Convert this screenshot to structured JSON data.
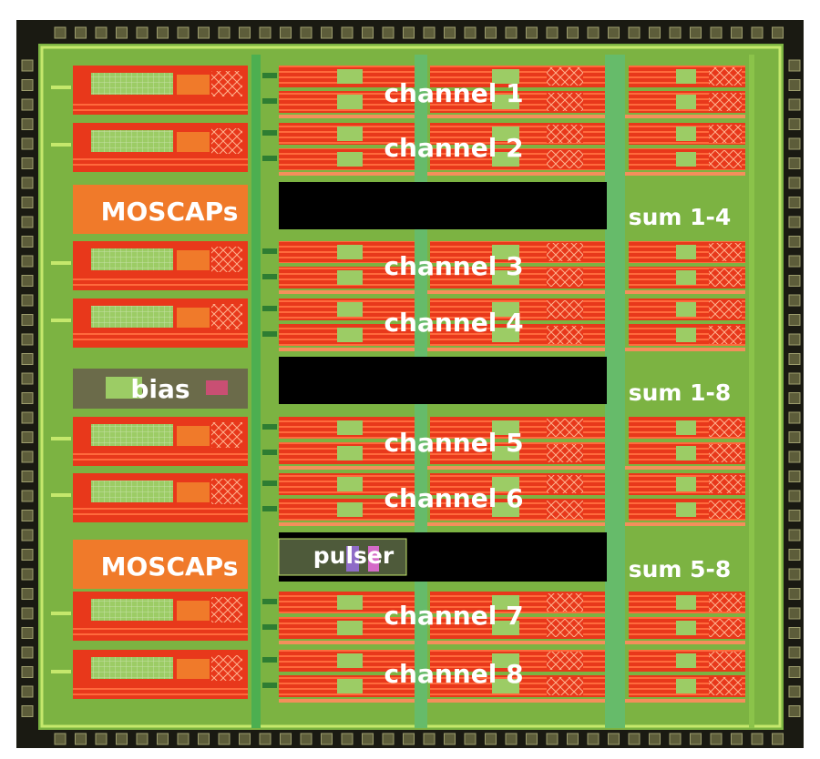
{
  "layout_title": "",
  "channels": [
    "channel 1",
    "channel 2",
    "channel 3",
    "channel 4",
    "channel 5",
    "channel 6",
    "channel 7",
    "channel 8"
  ],
  "left_blocks": {
    "moscaps_top": "MOSCAPs",
    "bias": "bias",
    "moscaps_bottom": "MOSCAPs"
  },
  "center_blocks": {
    "pulser": "pulser"
  },
  "sum_blocks": [
    "sum 1-4",
    "sum 1-8",
    "sum 5-8"
  ],
  "colors": {
    "frame": "#000000",
    "substrate": "#8bc34a",
    "circuit_red": "#e8381b",
    "circuit_orange": "#f07a2a",
    "capacitor_green": "#9ccc65",
    "pad": "#5d5d3a",
    "empty_area": "#000000",
    "label": "#ffffff"
  }
}
